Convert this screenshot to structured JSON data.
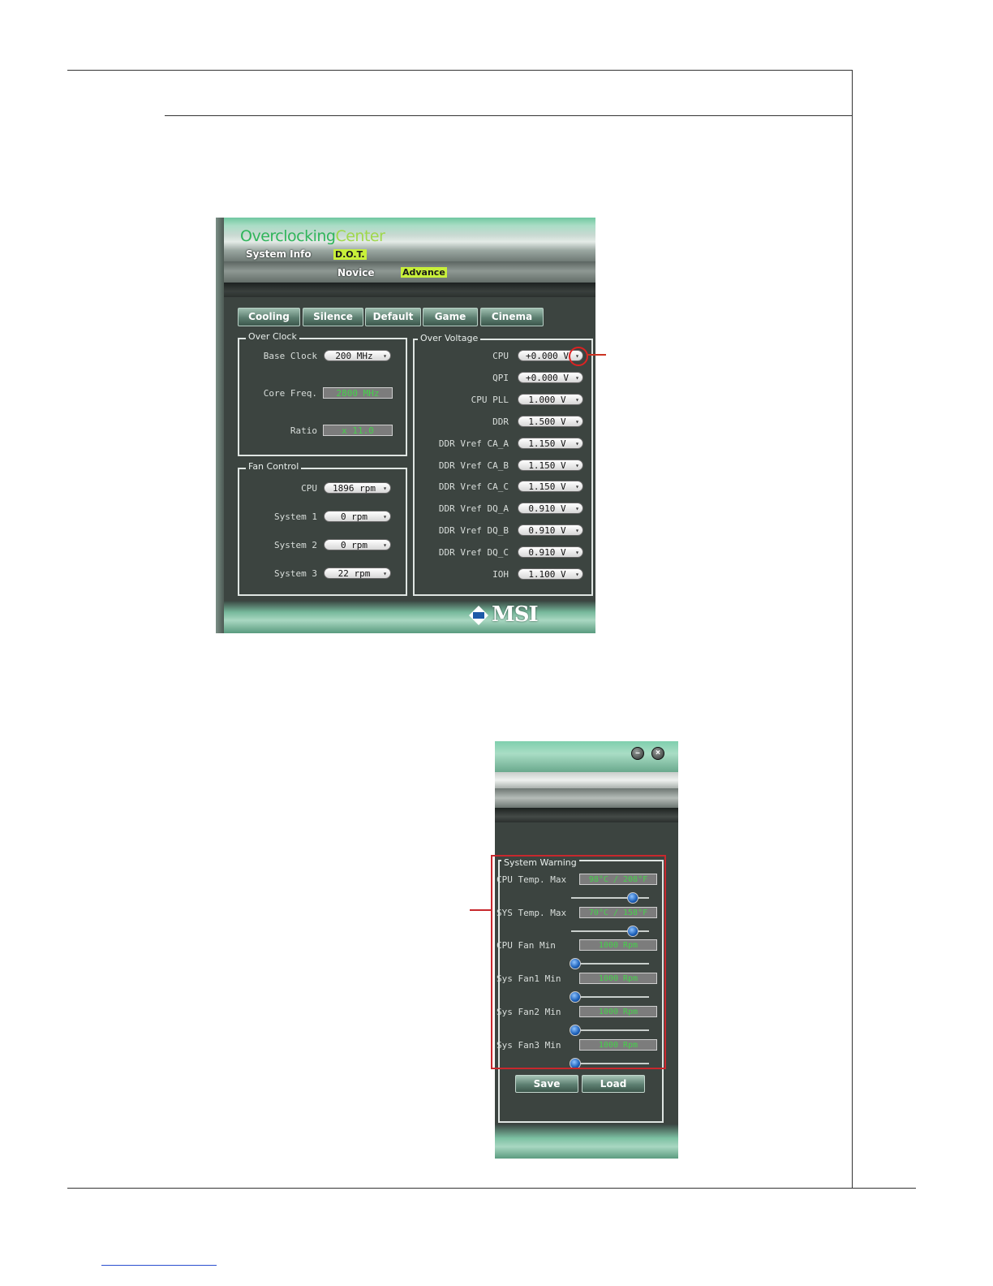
{
  "oc_window": {
    "title_part1": "Overclocking",
    "title_part2": "Center",
    "tab_system_info": "System Info",
    "tab_dot": "D.O.T.",
    "mode_novice": "Novice",
    "mode_advance": "Advance",
    "presets": [
      "Cooling",
      "Silence",
      "Default",
      "Game",
      "Cinema"
    ],
    "over_clock": {
      "title": "Over Clock",
      "base_clock_label": "Base Clock",
      "base_clock_value": "200 MHz",
      "core_freq_label": "Core Freq.",
      "core_freq_value": "2800 MHz",
      "ratio_label": "Ratio",
      "ratio_value": "x 11.0"
    },
    "fan_control": {
      "title": "Fan Control",
      "rows": [
        {
          "label": "CPU",
          "value": "1896 rpm"
        },
        {
          "label": "System 1",
          "value": "0 rpm"
        },
        {
          "label": "System 2",
          "value": "0 rpm"
        },
        {
          "label": "System 3",
          "value": "22 rpm"
        }
      ]
    },
    "over_voltage": {
      "title": "Over Voltage",
      "rows": [
        {
          "label": "CPU",
          "value": "+0.000 V"
        },
        {
          "label": "QPI",
          "value": "+0.000 V"
        },
        {
          "label": "CPU PLL",
          "value": "1.000 V"
        },
        {
          "label": "DDR",
          "value": "1.500 V"
        },
        {
          "label": "DDR Vref CA_A",
          "value": "1.150 V"
        },
        {
          "label": "DDR Vref CA_B",
          "value": "1.150 V"
        },
        {
          "label": "DDR Vref CA_C",
          "value": "1.150 V"
        },
        {
          "label": "DDR Vref DQ_A",
          "value": "0.910 V"
        },
        {
          "label": "DDR Vref DQ_B",
          "value": "0.910 V"
        },
        {
          "label": "DDR Vref DQ_C",
          "value": "0.910 V"
        },
        {
          "label": "IOH",
          "value": "1.100 V"
        }
      ]
    },
    "logo_text": "MSI"
  },
  "sw_window": {
    "min_glyph": "–",
    "close_glyph": "×",
    "group_title": "System Warning",
    "rows": [
      {
        "label": "CPU Temp. Max",
        "value": "98°C / 208°F",
        "level": 0.85
      },
      {
        "label": "SYS Temp. Max",
        "value": "70°C / 158°F",
        "level": 0.85
      },
      {
        "label": "CPU Fan Min",
        "value": "1000 Rpm",
        "level": 0.0
      },
      {
        "label": "Sys Fan1 Min",
        "value": "1000 Rpm",
        "level": 0.0
      },
      {
        "label": "Sys Fan2 Min",
        "value": "1000 Rpm",
        "level": 0.0
      },
      {
        "label": "Sys Fan3 Min",
        "value": "1000 Rpm",
        "level": 0.0
      }
    ],
    "save_label": "Save",
    "load_label": "Load"
  },
  "colors": {
    "accent_green": "#45d24a",
    "callout_red": "#c8282d",
    "title_green": "#2fb55b"
  }
}
